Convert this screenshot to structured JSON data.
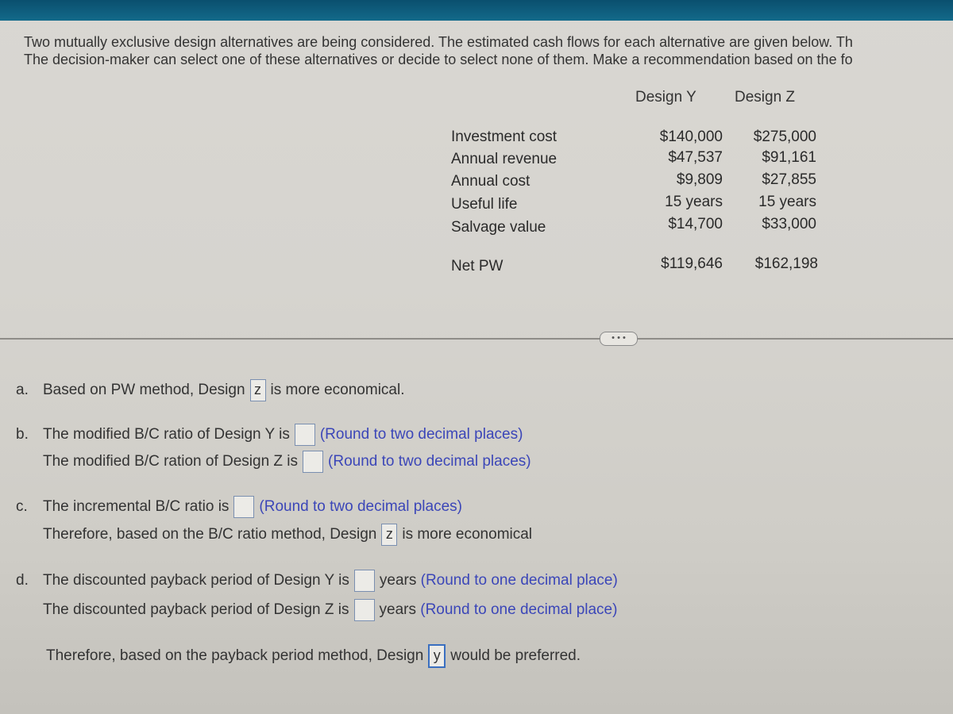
{
  "intro": {
    "line1": "Two mutually exclusive design alternatives are being considered. The estimated cash flows for each alternative are given below. Th",
    "line2": "The decision-maker can select one of these alternatives or decide to select none of them. Make a recommendation based on the fo"
  },
  "table": {
    "headers": [
      "Design Y",
      "Design Z"
    ],
    "rows": [
      {
        "label": "Investment cost",
        "y": "$140,000",
        "z": "$275,000"
      },
      {
        "label": "Annual revenue",
        "y": "$47,537",
        "z": "$91,161"
      },
      {
        "label": "Annual cost",
        "y": "$9,809",
        "z": "$27,855"
      },
      {
        "label": "Useful life",
        "y": "15 years",
        "z": "15 years"
      },
      {
        "label": "Salvage value",
        "y": "$14,700",
        "z": "$33,000"
      }
    ],
    "net_pw": {
      "label": "Net PW",
      "y": "$119,646",
      "z": "$162,198"
    }
  },
  "more_button": "• • •",
  "questions": {
    "a": {
      "letter": "a.",
      "before": "Based on PW method, Design",
      "answer": "z",
      "after": "is more economical."
    },
    "b1": {
      "letter": "b.",
      "before": "The modified B/C ratio of Design Y is",
      "answer": "",
      "hint": "(Round to two decimal places)"
    },
    "b2": {
      "before": "The modified B/C ration of Design Z is",
      "answer": "",
      "hint": "(Round to two decimal places)"
    },
    "c1": {
      "letter": "c.",
      "before": "The incremental B/C ratio is",
      "answer": "",
      "hint": "(Round to two decimal places)"
    },
    "c2": {
      "before": "Therefore, based on the B/C ratio method, Design",
      "answer": "z",
      "after": "is more economical"
    },
    "d1": {
      "letter": "d.",
      "before": "The discounted payback period of Design Y is",
      "answer": "",
      "unit": "years",
      "hint": "(Round to one decimal place)"
    },
    "d2": {
      "before": "The discounted payback period of Design Z is",
      "answer": "",
      "unit": "years",
      "hint": "(Round to one decimal place)"
    },
    "d3": {
      "before": "Therefore, based on the payback period method, Design",
      "answer": "y",
      "after": "would be preferred."
    }
  }
}
